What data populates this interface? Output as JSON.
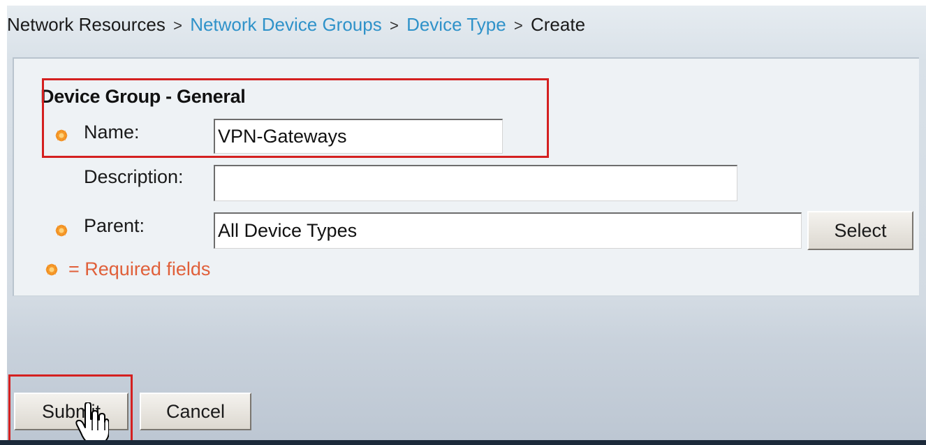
{
  "breadcrumb": {
    "item1": "Network Resources",
    "item2": "Network Device Groups",
    "item3": "Device Type",
    "item4": "Create",
    "separator": ">"
  },
  "form": {
    "section_title": "Device Group - General",
    "name_label": "Name:",
    "name_value": "VPN-Gateways",
    "description_label": "Description:",
    "description_value": "",
    "parent_label": "Parent:",
    "parent_value": "All Device Types",
    "select_label": "Select",
    "required_note": "= Required fields"
  },
  "actions": {
    "submit_label": "Submit",
    "cancel_label": "Cancel"
  },
  "icons": {
    "required": "required-field-icon",
    "cursor": "hand-pointer-icon"
  },
  "colors": {
    "link": "#2f92c9",
    "required_text": "#e0603a",
    "highlight": "#d42020",
    "required_icon": "#f08a1c"
  }
}
